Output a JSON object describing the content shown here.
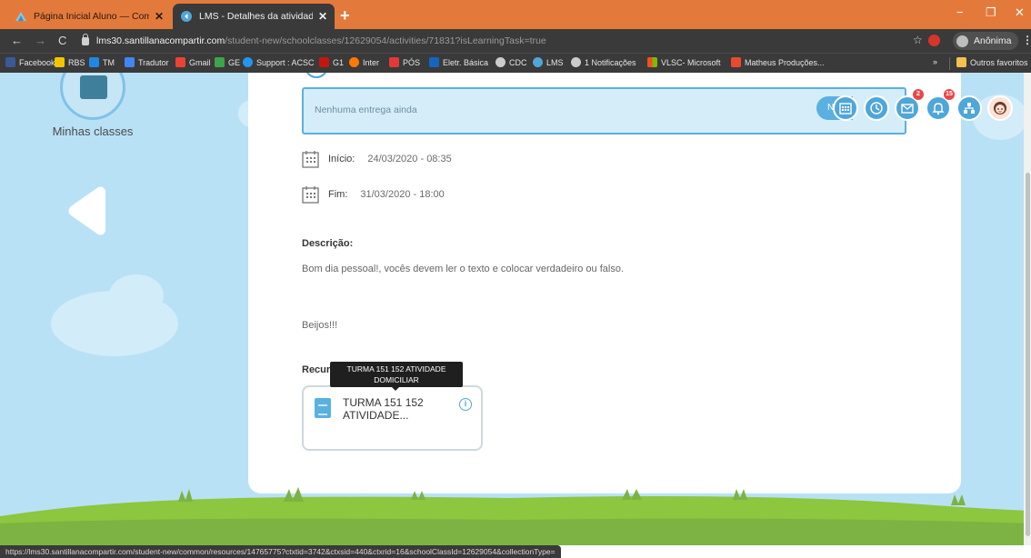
{
  "browser": {
    "tabs": [
      {
        "title": "Página Inicial Aluno — Compart",
        "active": false
      },
      {
        "title": "LMS - Detalhes da atividade",
        "active": true
      }
    ],
    "new_tab": "+",
    "window_controls": {
      "minimize": "−",
      "maximize": "❐",
      "close": "✕"
    },
    "url_host": "lms30.santillanacompartir.com",
    "url_path": "/student-new/schoolclasses/12629054/activities/71831?isLearningTask=true",
    "incognito_label": "Anônima",
    "bookmarks": [
      {
        "label": "Facebook",
        "color": "#3b5998"
      },
      {
        "label": "RBS",
        "color": "#f5c400"
      },
      {
        "label": "TM",
        "color": "#1e88e5"
      },
      {
        "label": "Tradutor",
        "color": "#4285f4"
      },
      {
        "label": "Gmail",
        "color": "#ea4335"
      },
      {
        "label": "GE",
        "color": "#3fa34d"
      },
      {
        "label": "Support : ACSC",
        "color": "#2196f3"
      },
      {
        "label": "G1",
        "color": "#c4170c"
      },
      {
        "label": "Inter",
        "color": "#ff7a00"
      },
      {
        "label": "PÓS",
        "color": "#e53935"
      },
      {
        "label": "Eletr. Básica",
        "color": "#1565c0"
      },
      {
        "label": "CDC",
        "color": "#cccccc"
      },
      {
        "label": "LMS",
        "color": "#4fa6d8"
      },
      {
        "label": "1 Notificações",
        "color": "#cccccc"
      },
      {
        "label": "VLSC- Microsoft",
        "color": "#f25022"
      },
      {
        "label": "Matheus Produções...",
        "color": "#e84a2f"
      }
    ],
    "bookmarks_more": "»",
    "other_bookmarks": "Outros favoritos",
    "status_url": "https://lms30.santillanacompartir.com/student-new/common/resources/14765775?ctxtid=3742&ctxsid=440&ctxrid=16&schoolClassId=12629054&collectionType="
  },
  "sidebar": {
    "classes_label": "Minhas classes"
  },
  "activity": {
    "delivery_status": "Nenhuma entrega ainda",
    "toolbar_pill": "N",
    "messages_badge": "2",
    "notifications_badge": "15",
    "start_label": "Início:",
    "start_value": "24/03/2020 - 08:35",
    "end_label": "Fim:",
    "end_value": "31/03/2020 - 18:00",
    "description_label": "Descrição:",
    "description_text": "Bom dia pessoal!, vocês devem ler o texto e colocar verdadeiro ou falso.",
    "description_signoff": "Beijos!!!",
    "resources_label": "Recursos:",
    "resource_tooltip": "TURMA 151 152 ATIVIDADE DOMICILIAR",
    "resource_name": "TURMA 151 152 ATIVIDADE..."
  },
  "colors": {
    "accent": "#4fa6d8",
    "page_bg": "#b9e1f6",
    "grass": "#8dc63f",
    "tab_strip": "#e37a3c"
  }
}
